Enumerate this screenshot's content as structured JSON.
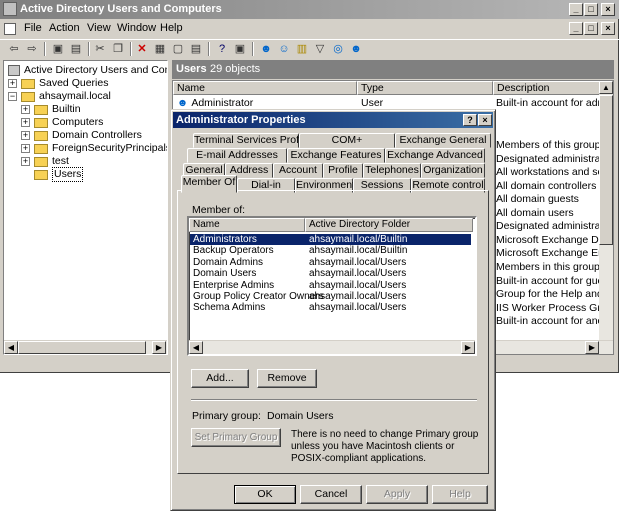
{
  "window": {
    "title": "Active Directory Users and Computers",
    "controls": [
      "_",
      "□",
      "×"
    ]
  },
  "menu": [
    "File",
    "Action",
    "View",
    "Window",
    "Help"
  ],
  "inner_controls": [
    "_",
    "□",
    "×"
  ],
  "toolbar_icons": [
    "back-icon",
    "forward-icon",
    "up-folder-icon",
    "show-tree-icon",
    "cut-icon",
    "copy-icon",
    "delete-icon",
    "properties-icon",
    "refresh-icon",
    "export-icon",
    "help-icon",
    "console-icon",
    "new-user-icon",
    "new-group-icon",
    "new-ou-icon",
    "filter-icon",
    "find-icon",
    "add-to-group-icon"
  ],
  "tree": {
    "root": "Active Directory Users and Computer",
    "items": [
      {
        "label": "Saved Queries",
        "level": 1,
        "expander": "+"
      },
      {
        "label": "ahsaymail.local",
        "level": 1,
        "expander": "−"
      },
      {
        "label": "Builtin",
        "level": 2,
        "expander": "+"
      },
      {
        "label": "Computers",
        "level": 2,
        "expander": "+"
      },
      {
        "label": "Domain Controllers",
        "level": 2,
        "expander": "+"
      },
      {
        "label": "ForeignSecurityPrincipals",
        "level": 2,
        "expander": "+"
      },
      {
        "label": "test",
        "level": 2,
        "expander": "+"
      },
      {
        "label": "Users",
        "level": 2,
        "expander": ""
      }
    ]
  },
  "list": {
    "heading": "Users",
    "count": "29 objects",
    "columns": [
      "Name",
      "Type",
      "Description"
    ],
    "first_row": {
      "name": "Administrator",
      "type": "User",
      "description": "Built-in account for admini..."
    },
    "descriptions": [
      "Members of this group are...",
      "Designated administrators...",
      "All workstations and serve...",
      "All domain controllers in th...",
      "All domain guests",
      "All domain users",
      "Designated administrators...",
      "Microsoft Exchange Domai...",
      "Microsoft Exchange Enter...",
      "Members in this group can...",
      "Built-in account for guest ...",
      "Group for the Help and Su...",
      "IIS Worker Process Group",
      "Built-in account for anony..."
    ]
  },
  "dialog": {
    "title": "Administrator Properties",
    "help_btn": "?",
    "close_btn": "×",
    "tabs_row1": [
      "Terminal Services Profile",
      "COM+",
      "Exchange General"
    ],
    "tabs_row2": [
      "E-mail Addresses",
      "Exchange Features",
      "Exchange Advanced"
    ],
    "tabs_row3": [
      "General",
      "Address",
      "Account",
      "Profile",
      "Telephones",
      "Organization"
    ],
    "tabs_row4": [
      "Member Of",
      "Dial-in",
      "Environment",
      "Sessions",
      "Remote control"
    ],
    "member_of_label": "Member of:",
    "columns": [
      "Name",
      "Active Directory Folder"
    ],
    "members": [
      {
        "name": "Administrators",
        "folder": "ahsaymail.local/Builtin",
        "selected": true
      },
      {
        "name": "Backup Operators",
        "folder": "ahsaymail.local/Builtin",
        "selected": false
      },
      {
        "name": "Domain Admins",
        "folder": "ahsaymail.local/Users",
        "selected": false
      },
      {
        "name": "Domain Users",
        "folder": "ahsaymail.local/Users",
        "selected": false
      },
      {
        "name": "Enterprise Admins",
        "folder": "ahsaymail.local/Users",
        "selected": false
      },
      {
        "name": "Group Policy Creator Owners",
        "folder": "ahsaymail.local/Users",
        "selected": false
      },
      {
        "name": "Schema Admins",
        "folder": "ahsaymail.local/Users",
        "selected": false
      }
    ],
    "add_button": "Add...",
    "remove_button": "Remove",
    "primary_group_label": "Primary group:",
    "primary_group_value": "Domain Users",
    "set_primary_button": "Set Primary Group",
    "primary_note": "There is no need to change Primary group unless you have Macintosh clients or POSIX-compliant applications.",
    "ok_button": "OK",
    "cancel_button": "Cancel",
    "apply_button": "Apply",
    "help_button": "Help"
  }
}
